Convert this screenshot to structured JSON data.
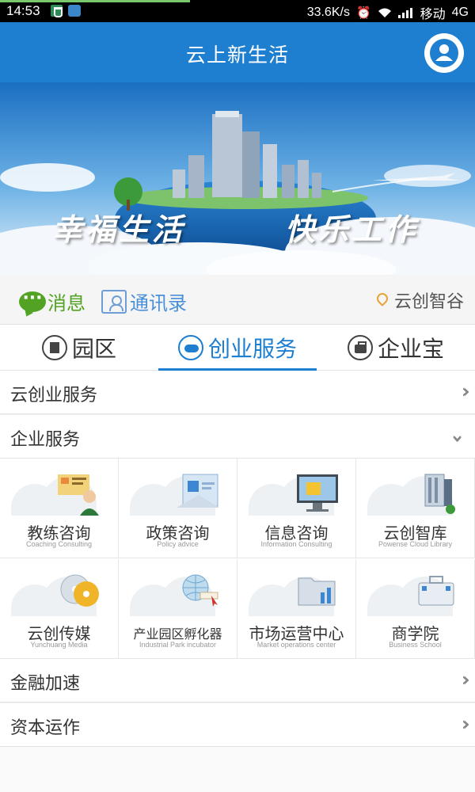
{
  "status_bar": {
    "time": "14:53",
    "speed": "33.6K/s",
    "carrier": "移动",
    "network": "4G"
  },
  "header": {
    "title": "云上新生活"
  },
  "banner": {
    "slogan_left": "幸福生活",
    "slogan_right": "快乐工作"
  },
  "quick_row": {
    "messages_label": "消息",
    "contacts_label": "通讯录",
    "location_label": "云创智谷"
  },
  "tabs": [
    {
      "label": "园区",
      "active": false
    },
    {
      "label": "创业服务",
      "active": true
    },
    {
      "label": "企业宝",
      "active": false
    }
  ],
  "sections": {
    "cloud_startup": "云创业服务",
    "enterprise": "企业服务",
    "finance": "金融加速",
    "capital": "资本运作"
  },
  "services": [
    {
      "name": "教练咨询",
      "subtitle": "Coaching Consulting"
    },
    {
      "name": "政策咨询",
      "subtitle": "Policy advice"
    },
    {
      "name": "信息咨询",
      "subtitle": "Information Consulting"
    },
    {
      "name": "云创智库",
      "subtitle": "Powense Cloud Library"
    },
    {
      "name": "云创传媒",
      "subtitle": "Yunchuang Media"
    },
    {
      "name": "产业园区孵化器",
      "subtitle": "Industrial Park incubator"
    },
    {
      "name": "市场运营中心",
      "subtitle": "Market operations center"
    },
    {
      "name": "商学院",
      "subtitle": "Business School"
    }
  ],
  "colors": {
    "brand_blue": "#1e7fd1",
    "message_green": "#52a323",
    "location_orange": "#e8a33a"
  }
}
